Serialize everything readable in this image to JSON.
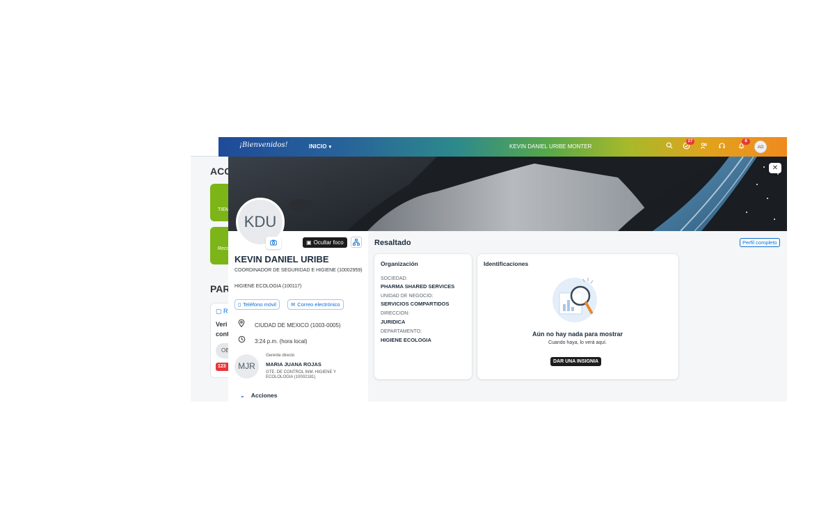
{
  "background": {
    "section_acc": "ACC",
    "tile1_text": "TIEM",
    "tile2_text": "Recon",
    "section_par": "PAR",
    "card_icon_text": "R",
    "card_line1": "Veri",
    "card_line2": "cont",
    "card_chip": "OB",
    "card_badge": "123"
  },
  "header": {
    "welcome": "¡Bienvenidos!",
    "nav_inicio": "INICIO",
    "user_name": "KEVIN DANIEL URIBE MONTER",
    "tasks_badge": "27",
    "notifications_badge": "8",
    "avatar_initials": "AO"
  },
  "profile": {
    "initials": "KDU",
    "focus_button": "Ocultar foco",
    "name": "KEVIN DANIEL URIBE",
    "job_title": "COORDINADOR DE SEGURIDAD E HIGIENE (10002959)",
    "department": "HIGIENE ECOLOGIA (100117)",
    "phone_button": "Teléfono móvil",
    "email_button": "Correo electrónico",
    "location": "CIUDAD DE MEXICO (1003-0005)",
    "local_time": "3:24 p.m. (hora local)",
    "manager": {
      "label": "Gerente directo",
      "initials": "MJR",
      "name": "MARIA JUANA ROJAS",
      "title": "GTE. DE CONTROL INM. HIGIENE Y ECOLOLOGIA (10002181)"
    },
    "actions_label": "Acciones"
  },
  "highlights": {
    "title": "Resaltado",
    "full_profile_button": "Perfil completo",
    "organization": {
      "title": "Organización",
      "fields": [
        {
          "label": "SOCIEDAD:",
          "value": "PHARMA SHARED SERVICES"
        },
        {
          "label": "UNIDAD DE NEGOCIO:",
          "value": "SERVICIOS COMPARTIDOS"
        },
        {
          "label": "DIRECCION:",
          "value": "JURIDICA"
        },
        {
          "label": "DEPARTAMENTO:",
          "value": "HIGIENE ECOLOGIA"
        }
      ]
    },
    "badges": {
      "title": "Identificaciones",
      "empty_title": "Aún no hay nada para mostrar",
      "empty_subtitle": "Cuando haya, lo verá aquí.",
      "give_button": "DAR UNA INSIGNIA"
    }
  },
  "colors": {
    "accent": "#0a6ed1",
    "badge_red": "#e5383b",
    "tile_green": "#7cb518",
    "dark_button": "#1d1d1d"
  },
  "icons": {
    "search": "search-icon",
    "tasks": "check-circle-icon",
    "people": "people-icon",
    "help": "headset-icon",
    "bell": "bell-icon",
    "close": "close-icon",
    "camera": "camera-icon",
    "org_chart": "org-chart-icon",
    "phone": "phone-icon",
    "mail": "mail-icon",
    "location": "location-pin-icon",
    "clock": "clock-icon",
    "chevron": "chevron-down-icon"
  }
}
